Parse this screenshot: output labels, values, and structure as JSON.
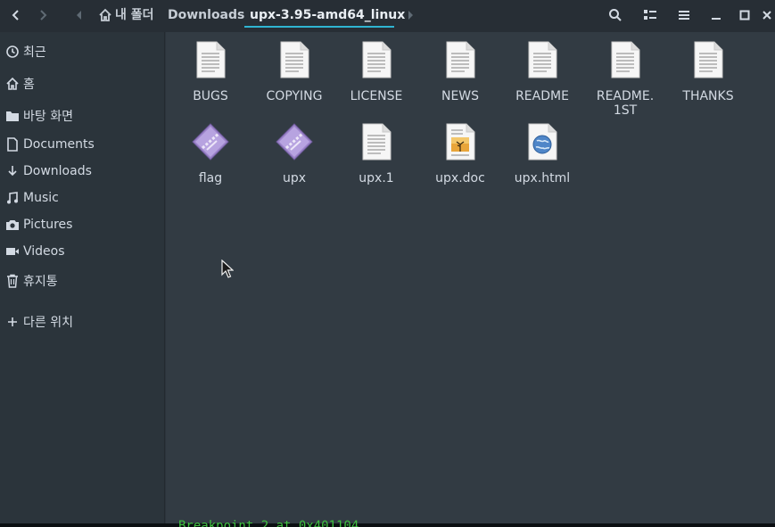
{
  "header": {
    "breadcrumbs": [
      {
        "label": "내 폴더"
      },
      {
        "label": "Downloads"
      },
      {
        "label": "upx-3.95-amd64_linux"
      }
    ]
  },
  "sidebar": {
    "items": [
      {
        "label": "최근",
        "icon": "clock-icon"
      },
      {
        "label": "홈",
        "icon": "home-icon"
      },
      {
        "label": "바탕 화면",
        "icon": "folder-icon"
      },
      {
        "label": "Documents",
        "icon": "document-icon"
      },
      {
        "label": "Downloads",
        "icon": "download-icon"
      },
      {
        "label": "Music",
        "icon": "music-icon"
      },
      {
        "label": "Pictures",
        "icon": "camera-icon"
      },
      {
        "label": "Videos",
        "icon": "video-icon"
      },
      {
        "label": "휴지통",
        "icon": "trash-icon"
      },
      {
        "label": "다른 위치",
        "icon": "plus-icon"
      }
    ]
  },
  "files": [
    {
      "name": "BUGS",
      "type": "text"
    },
    {
      "name": "COPYING",
      "type": "text"
    },
    {
      "name": "LICENSE",
      "type": "text"
    },
    {
      "name": "NEWS",
      "type": "text"
    },
    {
      "name": "README",
      "type": "text"
    },
    {
      "name": "README.\n1ST",
      "type": "text"
    },
    {
      "name": "THANKS",
      "type": "text"
    },
    {
      "name": "flag",
      "type": "executable"
    },
    {
      "name": "upx",
      "type": "executable"
    },
    {
      "name": "upx.1",
      "type": "text"
    },
    {
      "name": "upx.doc",
      "type": "document"
    },
    {
      "name": "upx.html",
      "type": "html"
    }
  ],
  "background_terminal_text": "Breakpoint 2 at 0x401104"
}
